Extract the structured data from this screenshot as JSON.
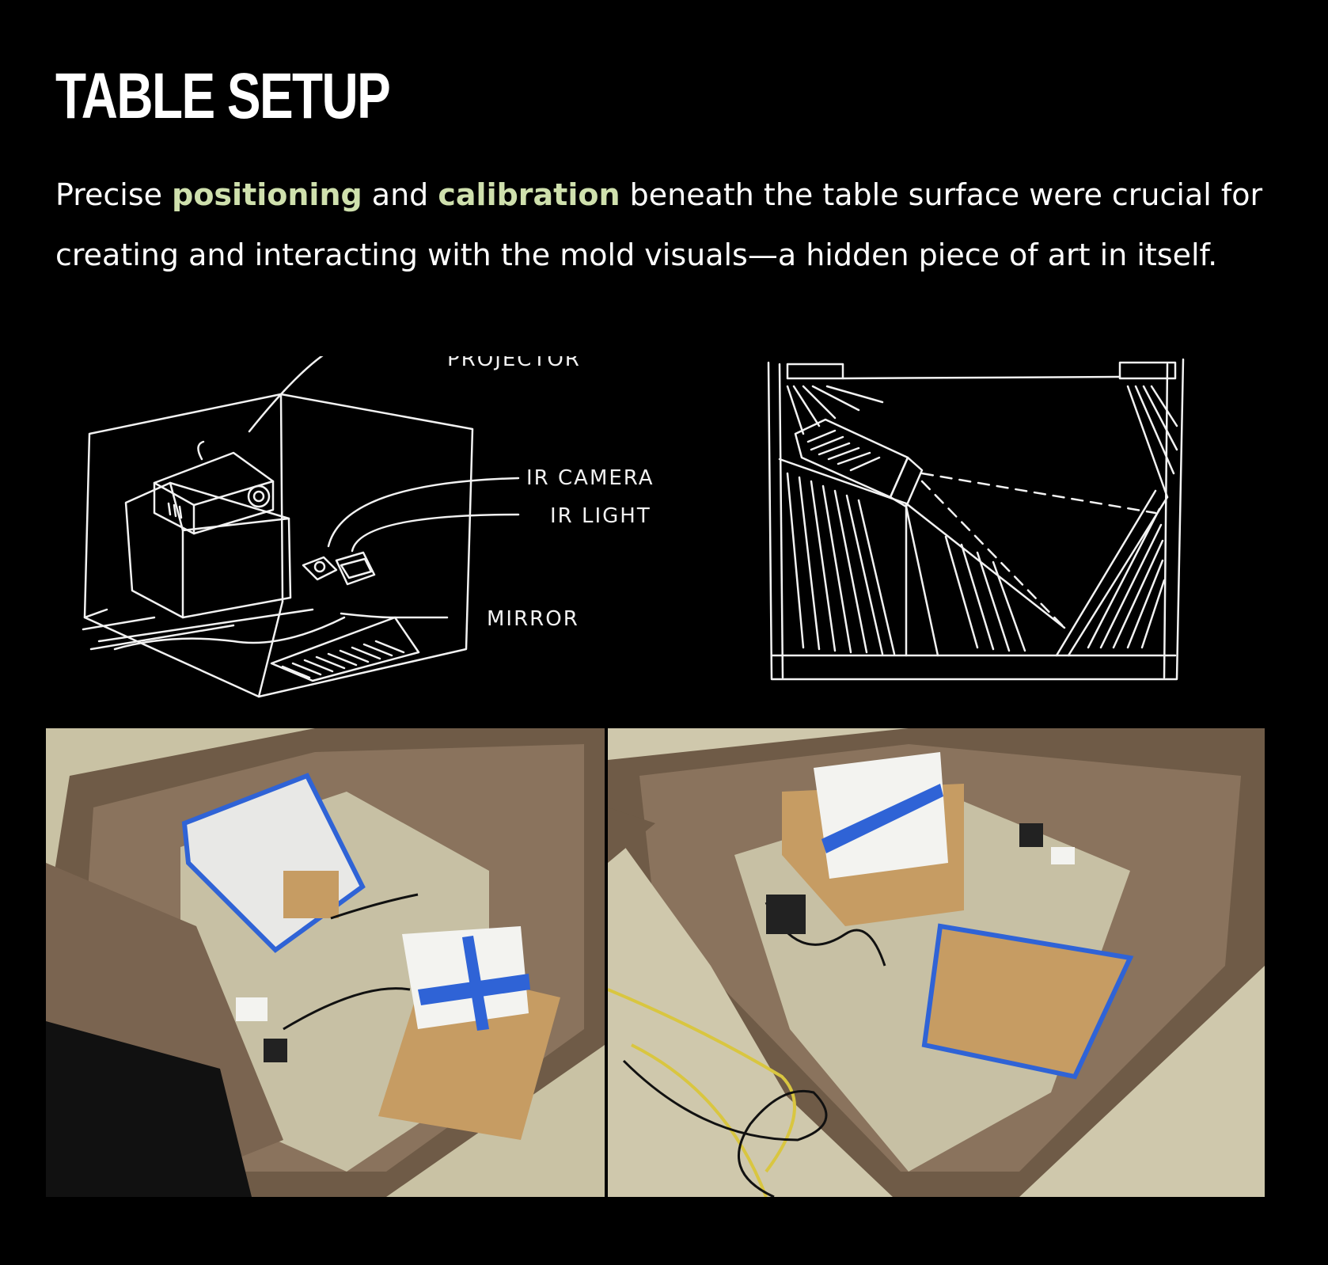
{
  "section": {
    "title": "TABLE SETUP",
    "intro": {
      "lead": "Precise ",
      "highlight_1": "positioning",
      "mid": " and ",
      "highlight_2": "calibration",
      "tail": " beneath the table surface were crucial for creating and interacting with the mold visuals—a hidden piece of art in itself."
    },
    "highlight_color": "#cfe0ad"
  },
  "sketch_labels": {
    "projector": "PROJECTOR",
    "ir_camera": "IR CAMERA",
    "ir_light": "IR LIGHT",
    "mirror": "MIRROR"
  },
  "colors": {
    "background": "#000000",
    "tape_blue": "#2f63d6",
    "cardboard": "#7d6652",
    "floor": "#c8c1a6",
    "wood": "#c49c63"
  }
}
